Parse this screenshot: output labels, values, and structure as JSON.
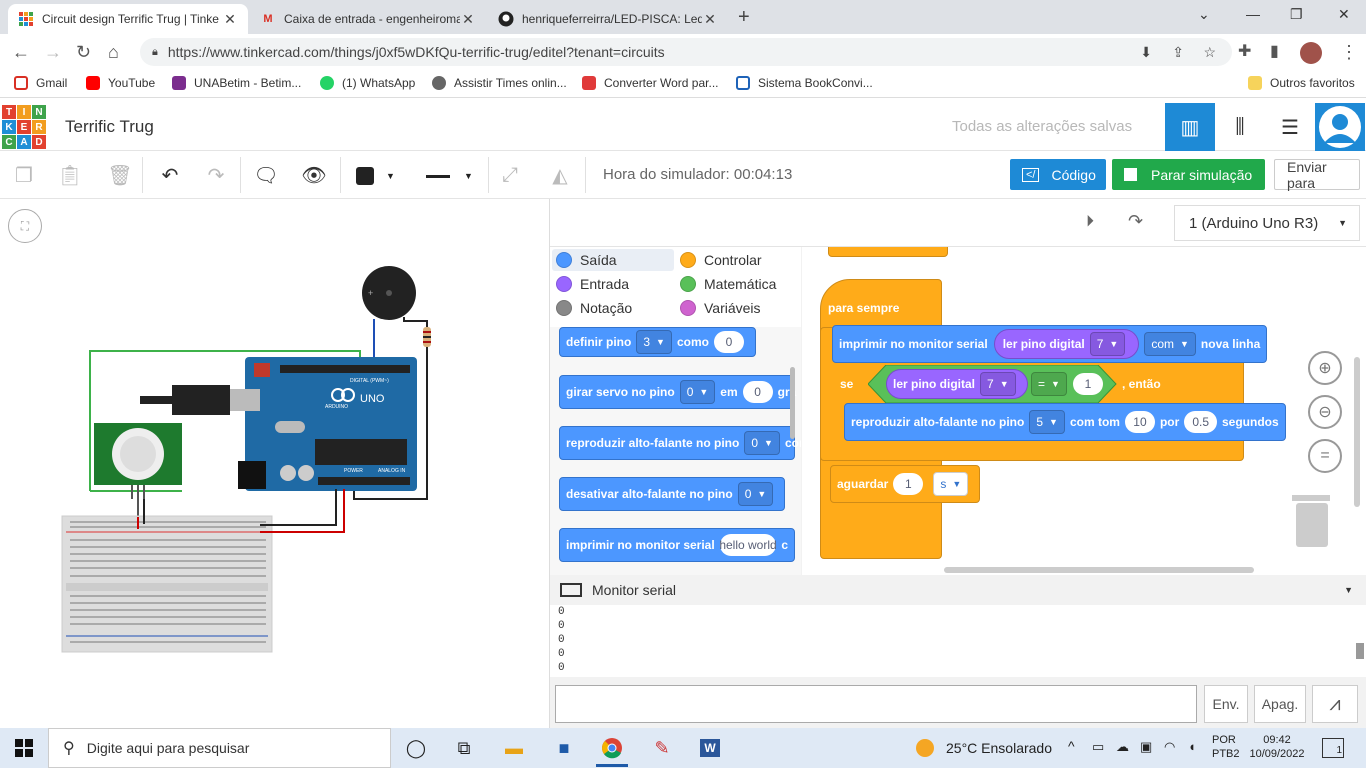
{
  "browser": {
    "tabs": [
      {
        "title": "Circuit design Terrific Trug | Tinke",
        "active": true
      },
      {
        "title": "Caixa de entrada - engenheiroma",
        "active": false
      },
      {
        "title": "henriqueferreirra/LED-PISCA: Led",
        "active": false
      }
    ],
    "new_tab": "+",
    "url": "https://www.tinkercad.com/things/j0xf5wDKfQu-terrific-trug/editel?tenant=circuits",
    "bookmarks": [
      "Gmail",
      "YouTube",
      "UNABetim - Betim...",
      "(1) WhatsApp",
      "Assistir Times onlin...",
      "Converter Word par...",
      "Sistema BookConvi..."
    ],
    "other_bookmarks": "Outros favoritos"
  },
  "tinkercad": {
    "logo_letters": [
      "T",
      "I",
      "N",
      "K",
      "E",
      "R",
      "C",
      "A",
      "D"
    ],
    "project_title": "Terrific Trug",
    "save_status": "Todas as alterações salvas",
    "toolbar": {
      "sim_time": "Hora do simulador: 00:04:13",
      "code_label": "Código",
      "stop_sim_label": "Parar simulação",
      "send_label": "Enviar para"
    },
    "device_select": "1 (Arduino Uno R3)",
    "categories": [
      {
        "label": "Saída",
        "color": "#4c97ff"
      },
      {
        "label": "Controlar",
        "color": "#ffab19"
      },
      {
        "label": "Entrada",
        "color": "#9966ff"
      },
      {
        "label": "Matemática",
        "color": "#59c059"
      },
      {
        "label": "Notação",
        "color": "#888888"
      },
      {
        "label": "Variáveis",
        "color": "#cf63cf"
      }
    ],
    "palette": {
      "definir_pino": "definir pino",
      "definir_pino_val": "3",
      "como": "como",
      "como_val": "0",
      "girar_servo": "girar servo no pino",
      "girar_servo_val": "0",
      "em": "em",
      "em_val": "0",
      "gra": "gra",
      "reproduzir": "reproduzir alto-falante no pino",
      "reproduzir_val": "0",
      "com": "com",
      "desativar": "desativar alto-falante no pino",
      "desativar_val": "0",
      "imprimir": "imprimir no monitor serial",
      "imprimir_val": "hello world",
      "c": "c"
    },
    "workspace": {
      "para_sempre": "para sempre",
      "imprimir": "imprimir no monitor serial",
      "ler_pino": "ler pino digital",
      "ler_pino_val": "7",
      "com_dd": "com",
      "nova_linha": "nova linha",
      "se": "se",
      "ler_pino2": "ler pino digital",
      "ler_pino2_val": "7",
      "eq": "=",
      "eq_val": "1",
      "entao": ", então",
      "reproduzir": "reproduzir alto-falante no pino",
      "reproduzir_pin": "5",
      "com_tom": "com tom",
      "tom_val": "10",
      "por": "por",
      "por_val": "0.5",
      "segundos": "segundos",
      "aguardar": "aguardar",
      "aguardar_val": "1",
      "unit": "s"
    },
    "serial": {
      "title": "Monitor serial",
      "lines": [
        "0",
        "0",
        "0",
        "0",
        "0"
      ],
      "send": "Env.",
      "clear": "Apag."
    },
    "board_labels": {
      "uno": "UNO",
      "arduino": "ARDUINO",
      "digital": "DIGITAL (PWM~)",
      "power": "POWER",
      "analog": "ANALOG IN"
    }
  },
  "taskbar": {
    "search_placeholder": "Digite aqui para pesquisar",
    "weather": "25°C  Ensolarado",
    "lang1": "POR",
    "lang2": "PTB2",
    "time": "09:42",
    "date": "10/09/2022",
    "notif_count": "1"
  }
}
